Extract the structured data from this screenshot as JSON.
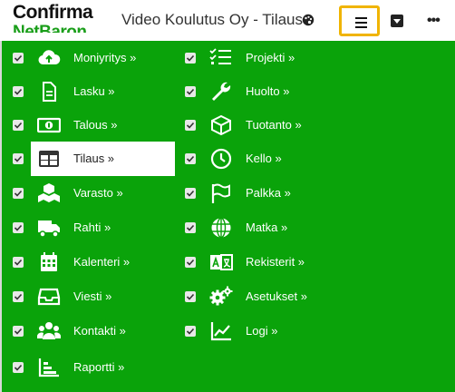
{
  "header": {
    "logo_main": "Confirma",
    "logo_sub": "NetBaron",
    "title": "Video Koulutus Oy - Tilaus"
  },
  "colors": {
    "menu_bg": "#0aa30a",
    "highlight": "#f0b400",
    "active_bg": "#ffffff"
  },
  "menu": {
    "left": [
      {
        "label": "Moniyritys »",
        "icon": "cloud-upload-icon"
      },
      {
        "label": "Lasku »",
        "icon": "document-icon"
      },
      {
        "label": "Talous »",
        "icon": "banknote-icon"
      },
      {
        "label": "Tilaus »",
        "icon": "table-icon",
        "active": true
      },
      {
        "label": "Varasto »",
        "icon": "boxes-icon"
      },
      {
        "label": "Rahti »",
        "icon": "truck-icon"
      },
      {
        "label": "Kalenteri »",
        "icon": "calendar-icon"
      },
      {
        "label": "Viesti »",
        "icon": "inbox-icon"
      },
      {
        "label": "Kontakti »",
        "icon": "users-icon"
      },
      {
        "label": "Raportti »",
        "icon": "report-icon"
      }
    ],
    "right": [
      {
        "label": "Projekti »",
        "icon": "tasks-icon"
      },
      {
        "label": "Huolto »",
        "icon": "wrench-icon"
      },
      {
        "label": "Tuotanto »",
        "icon": "cube-icon"
      },
      {
        "label": "Kello »",
        "icon": "clock-icon"
      },
      {
        "label": "Palkka »",
        "icon": "flag-icon"
      },
      {
        "label": "Matka »",
        "icon": "globe-icon"
      },
      {
        "label": "Rekisterit »",
        "icon": "language-icon"
      },
      {
        "label": "Asetukset »",
        "icon": "gears-icon"
      },
      {
        "label": "Logi »",
        "icon": "line-chart-icon"
      }
    ]
  }
}
